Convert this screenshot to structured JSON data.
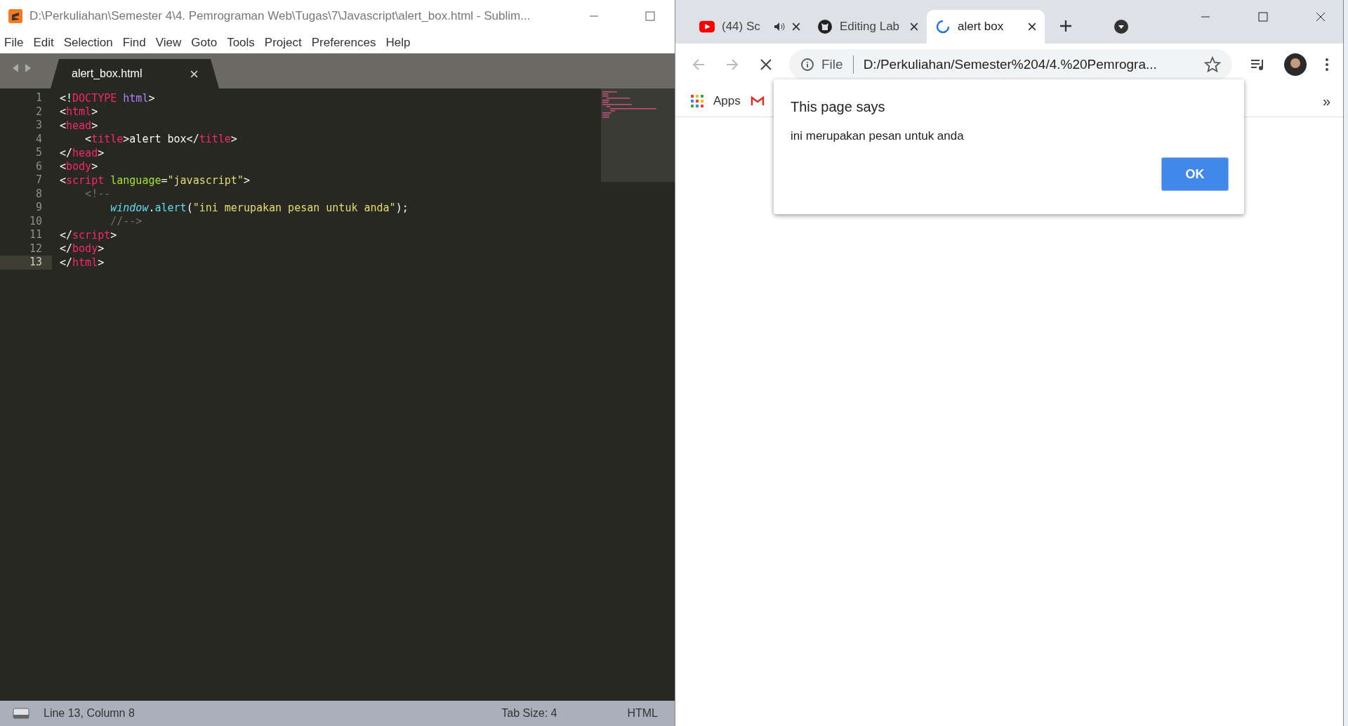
{
  "editor": {
    "title": "D:\\Perkuliahan\\Semester 4\\4. Pemrograman Web\\Tugas\\7\\Javascript\\alert_box.html - Sublim...",
    "menu": [
      "File",
      "Edit",
      "Selection",
      "Find",
      "View",
      "Goto",
      "Tools",
      "Project",
      "Preferences",
      "Help"
    ],
    "tabs": [
      {
        "label": "alert_box.html",
        "selected": true
      }
    ],
    "lines": [
      {
        "number": "1",
        "current": false,
        "tokens": [
          {
            "kind": "punct",
            "text": "<!"
          },
          {
            "kind": "tag",
            "text": "DOCTYPE"
          },
          {
            "kind": "keyword",
            "text": " html"
          },
          {
            "kind": "punct",
            "text": ">"
          }
        ]
      },
      {
        "number": "2",
        "current": false,
        "tokens": [
          {
            "kind": "punct",
            "text": "<"
          },
          {
            "kind": "tag",
            "text": "html"
          },
          {
            "kind": "punct",
            "text": ">"
          }
        ]
      },
      {
        "number": "3",
        "current": false,
        "tokens": [
          {
            "kind": "punct",
            "text": "<"
          },
          {
            "kind": "tag",
            "text": "head"
          },
          {
            "kind": "punct",
            "text": ">"
          }
        ]
      },
      {
        "number": "4",
        "current": false,
        "tokens": [
          {
            "kind": "punct",
            "text": "    <"
          },
          {
            "kind": "tag",
            "text": "title"
          },
          {
            "kind": "punct",
            "text": ">alert box</"
          },
          {
            "kind": "tag",
            "text": "title"
          },
          {
            "kind": "punct",
            "text": ">"
          }
        ]
      },
      {
        "number": "5",
        "current": false,
        "tokens": [
          {
            "kind": "punct",
            "text": "</"
          },
          {
            "kind": "tag",
            "text": "head"
          },
          {
            "kind": "punct",
            "text": ">"
          }
        ]
      },
      {
        "number": "6",
        "current": false,
        "tokens": [
          {
            "kind": "punct",
            "text": "<"
          },
          {
            "kind": "tag",
            "text": "body"
          },
          {
            "kind": "punct",
            "text": ">"
          }
        ]
      },
      {
        "number": "7",
        "current": false,
        "tokens": [
          {
            "kind": "punct",
            "text": "<"
          },
          {
            "kind": "tag",
            "text": "script"
          },
          {
            "kind": "attr",
            "text": " language"
          },
          {
            "kind": "punct",
            "text": "="
          },
          {
            "kind": "string",
            "text": "\"javascript\""
          },
          {
            "kind": "punct",
            "text": ">"
          }
        ]
      },
      {
        "number": "8",
        "current": false,
        "tokens": [
          {
            "kind": "comment",
            "text": "    <!--"
          }
        ]
      },
      {
        "number": "9",
        "current": false,
        "tokens": [
          {
            "kind": "var",
            "text": "        window"
          },
          {
            "kind": "punct",
            "text": "."
          },
          {
            "kind": "func",
            "text": "alert"
          },
          {
            "kind": "punct",
            "text": "("
          },
          {
            "kind": "string",
            "text": "\"ini merupakan pesan untuk anda\""
          },
          {
            "kind": "punct",
            "text": ");"
          }
        ]
      },
      {
        "number": "10",
        "current": false,
        "tokens": [
          {
            "kind": "comment",
            "text": "        //-->"
          }
        ]
      },
      {
        "number": "11",
        "current": false,
        "tokens": [
          {
            "kind": "punct",
            "text": "</"
          },
          {
            "kind": "tag",
            "text": "script"
          },
          {
            "kind": "punct",
            "text": ">"
          }
        ]
      },
      {
        "number": "12",
        "current": false,
        "tokens": [
          {
            "kind": "punct",
            "text": "</"
          },
          {
            "kind": "tag",
            "text": "body"
          },
          {
            "kind": "punct",
            "text": ">"
          }
        ]
      },
      {
        "number": "13",
        "current": true,
        "tokens": [
          {
            "kind": "punct",
            "text": "</"
          },
          {
            "kind": "tag",
            "text": "html"
          },
          {
            "kind": "punct",
            "text": ">"
          }
        ]
      }
    ],
    "status": {
      "position": "Line 13, Column 8",
      "tab_size": "Tab Size: 4",
      "syntax": "HTML"
    }
  },
  "browser": {
    "tabs": [
      {
        "kind": "youtube",
        "title": "(44) Sc",
        "audio": true,
        "selected": false
      },
      {
        "kind": "github",
        "title": "Editing Lab",
        "audio": false,
        "selected": false
      },
      {
        "kind": "loading",
        "title": "alert box",
        "audio": false,
        "selected": true
      }
    ],
    "back_disabled": true,
    "forward_disabled": true,
    "address": {
      "scheme": "File",
      "url": "D:/Perkuliahan/Semester%204/4.%20Pemrogra..."
    },
    "bookmarks": [
      {
        "kind": "apps",
        "label": "Apps"
      },
      {
        "kind": "gmail"
      }
    ],
    "overflow": "»",
    "dialog": {
      "title": "This page says",
      "message": "ini merupakan pesan untuk anda",
      "button": "OK"
    }
  }
}
